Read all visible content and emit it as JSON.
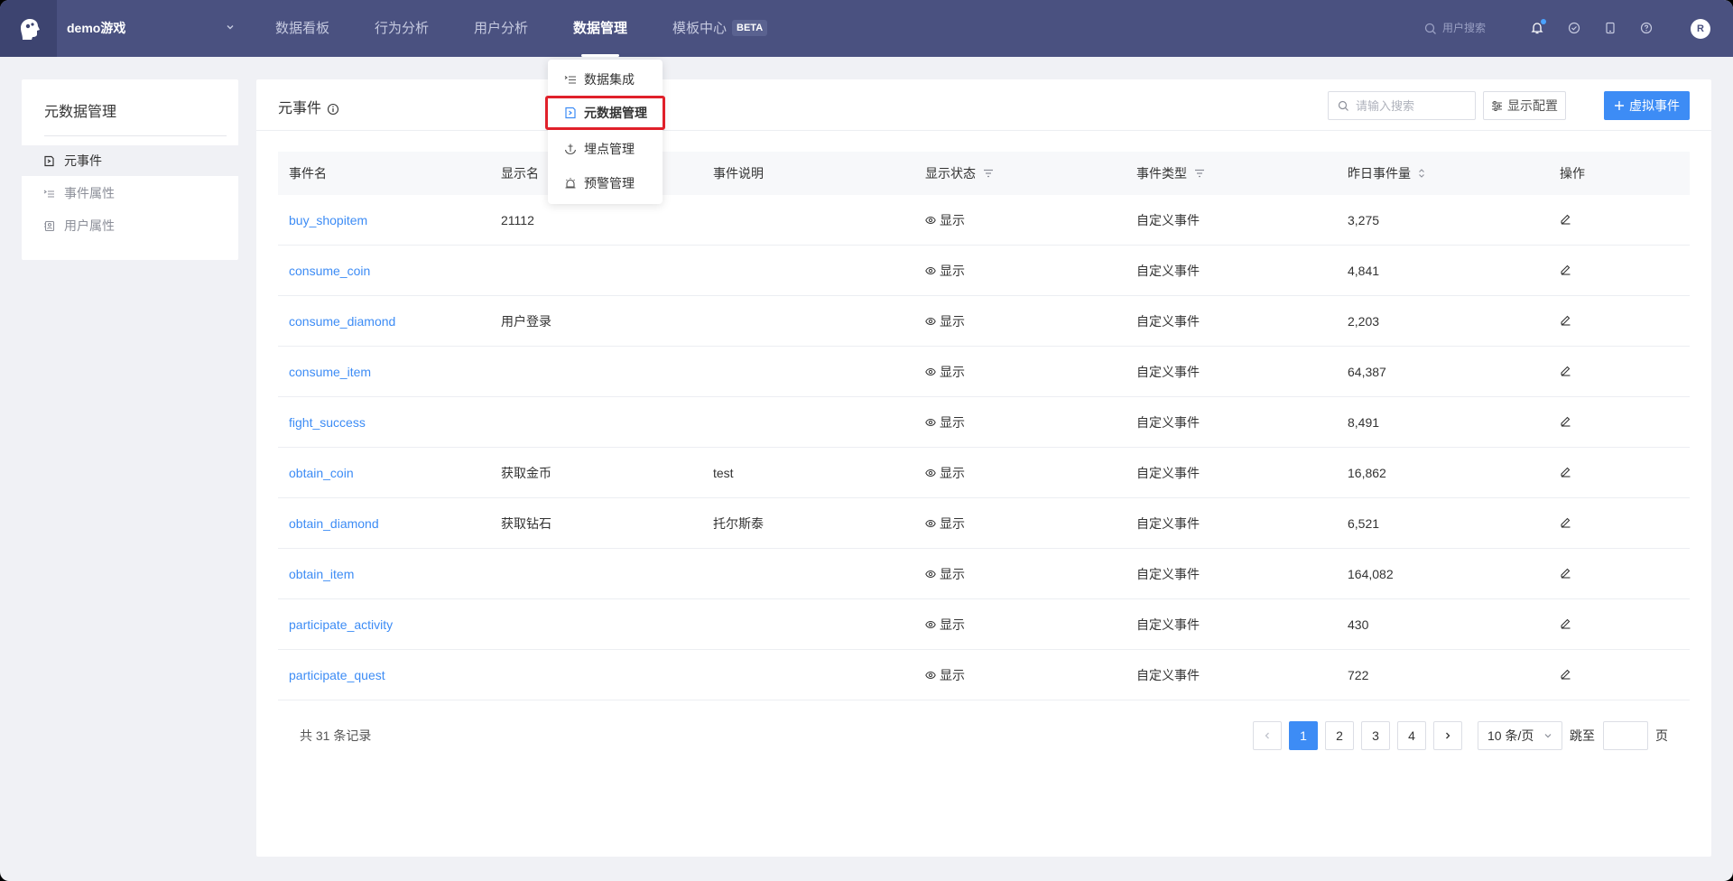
{
  "topnav": {
    "project": "demo游戏",
    "items": [
      {
        "label": "数据看板"
      },
      {
        "label": "行为分析"
      },
      {
        "label": "用户分析"
      },
      {
        "label": "数据管理"
      },
      {
        "label": "模板中心"
      }
    ],
    "beta": "BETA",
    "user_search": "用户搜索",
    "avatar": "R",
    "icons": [
      "bell-icon",
      "check-circle-icon",
      "mobile-icon",
      "help-icon"
    ]
  },
  "dropdown": {
    "items": [
      {
        "label": "数据集成",
        "icon": "list-tree-icon"
      },
      {
        "label": "元数据管理",
        "icon": "document-icon"
      },
      {
        "label": "埋点管理",
        "icon": "anchor-icon"
      },
      {
        "label": "预警管理",
        "icon": "alarm-icon"
      }
    ]
  },
  "sidebar": {
    "title": "元数据管理",
    "items": [
      {
        "label": "元事件"
      },
      {
        "label": "事件属性"
      },
      {
        "label": "用户属性"
      }
    ]
  },
  "main": {
    "title": "元事件",
    "search_placeholder": "请输入搜索",
    "config_label": "显示配置",
    "add_label": "虚拟事件"
  },
  "table": {
    "headers": [
      "事件名",
      "显示名",
      "事件说明",
      "显示状态",
      "事件类型",
      "昨日事件量",
      "操作"
    ],
    "rows": [
      {
        "name": "buy_shopitem",
        "display": "21112",
        "desc": "",
        "status": "显示",
        "type": "自定义事件",
        "count": "3,275"
      },
      {
        "name": "consume_coin",
        "display": "",
        "desc": "",
        "status": "显示",
        "type": "自定义事件",
        "count": "4,841"
      },
      {
        "name": "consume_diamond",
        "display": "用户登录",
        "desc": "",
        "status": "显示",
        "type": "自定义事件",
        "count": "2,203"
      },
      {
        "name": "consume_item",
        "display": "",
        "desc": "",
        "status": "显示",
        "type": "自定义事件",
        "count": "64,387"
      },
      {
        "name": "fight_success",
        "display": "",
        "desc": "",
        "status": "显示",
        "type": "自定义事件",
        "count": "8,491"
      },
      {
        "name": "obtain_coin",
        "display": "获取金币",
        "desc": "test",
        "status": "显示",
        "type": "自定义事件",
        "count": "16,862"
      },
      {
        "name": "obtain_diamond",
        "display": "获取钻石",
        "desc": "托尔斯泰",
        "status": "显示",
        "type": "自定义事件",
        "count": "6,521"
      },
      {
        "name": "obtain_item",
        "display": "",
        "desc": "",
        "status": "显示",
        "type": "自定义事件",
        "count": "164,082"
      },
      {
        "name": "participate_activity",
        "display": "",
        "desc": "",
        "status": "显示",
        "type": "自定义事件",
        "count": "430"
      },
      {
        "name": "participate_quest",
        "display": "",
        "desc": "",
        "status": "显示",
        "type": "自定义事件",
        "count": "722"
      }
    ]
  },
  "pagination": {
    "total": "共 31 条记录",
    "pages": [
      "1",
      "2",
      "3",
      "4"
    ],
    "current": "1",
    "page_size": "10 条/页",
    "jump_label": "跳至",
    "page_suffix": "页"
  }
}
